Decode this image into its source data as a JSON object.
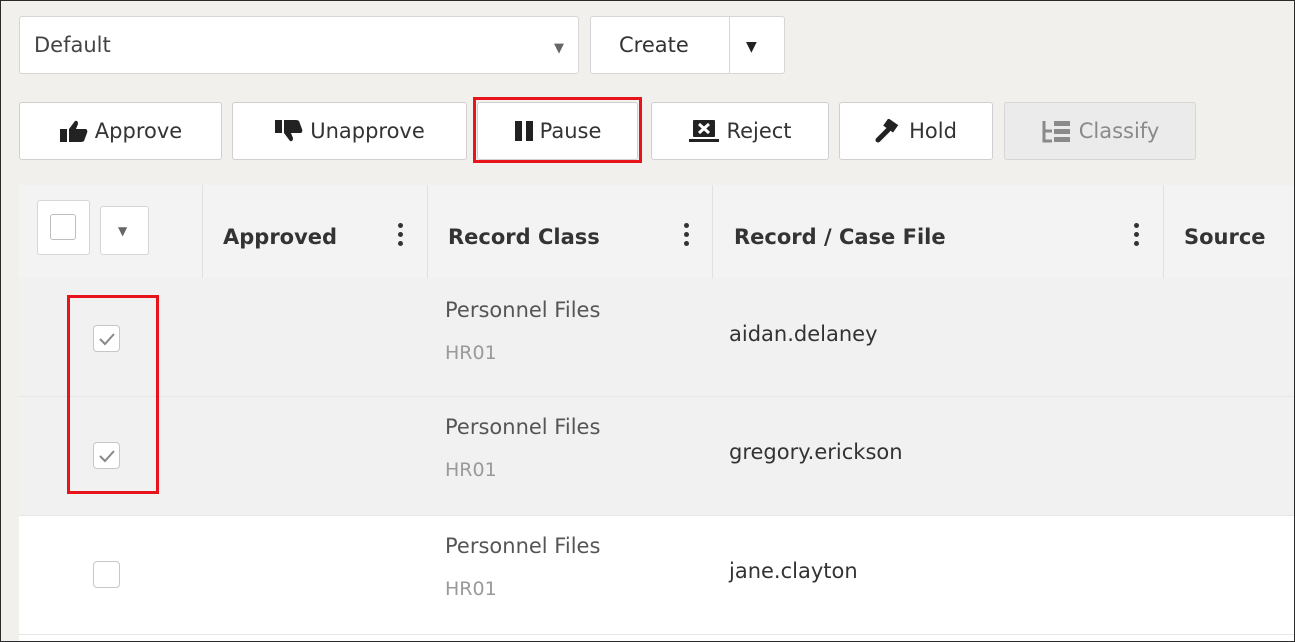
{
  "view_selector": {
    "value": "Default"
  },
  "create": {
    "label": "Create"
  },
  "toolbar": {
    "approve": "Approve",
    "unapprove": "Unapprove",
    "pause": "Pause",
    "reject": "Reject",
    "hold": "Hold",
    "classify": "Classify"
  },
  "table": {
    "columns": [
      "Approved",
      "Record Class",
      "Record / Case File",
      "Source"
    ],
    "rows": [
      {
        "record_class": "Personnel Files",
        "class_code": "HR01",
        "record": "aidan.delaney",
        "checked": true
      },
      {
        "record_class": "Personnel Files",
        "class_code": "HR01",
        "record": "gregory.erickson",
        "checked": true
      },
      {
        "record_class": "Personnel Files",
        "class_code": "HR01",
        "record": "jane.clayton",
        "checked": false
      }
    ]
  },
  "colors": {
    "highlight": "#e8141b",
    "selected_row": "#f1f1f1"
  }
}
